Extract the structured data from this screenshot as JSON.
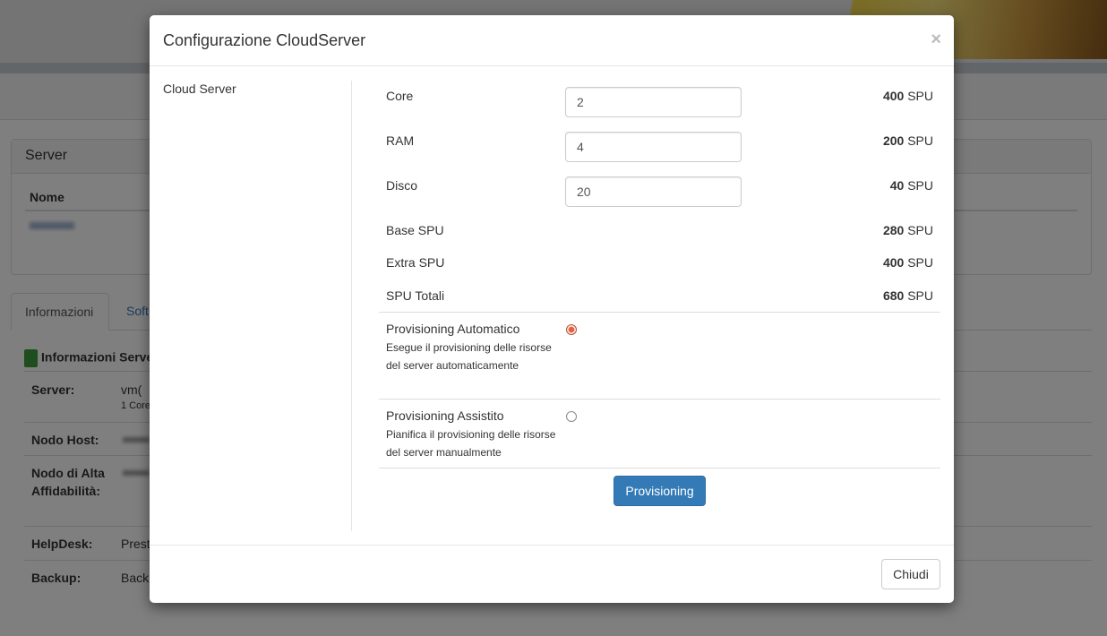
{
  "background": {
    "panel_title": "Server",
    "table_header_name": "Nome",
    "tabs": [
      {
        "label": "Informazioni"
      },
      {
        "label": "Soft"
      }
    ],
    "info_section_title": "Informazioni Serve",
    "info_rows": [
      {
        "label": "Server:",
        "value": "vm(",
        "sub": "1 Core"
      },
      {
        "label": "Nodo Host:",
        "value": ""
      },
      {
        "label": "Nodo di Alta Affidabilità:",
        "value": ""
      },
      {
        "label": "HelpDesk:",
        "value": "Prest"
      },
      {
        "label": "Backup:",
        "value": "Back"
      }
    ]
  },
  "modal": {
    "title": "Configurazione CloudServer",
    "close_symbol": "×",
    "sidebar_label": "Cloud Server",
    "inputs": [
      {
        "label": "Core",
        "value": "2",
        "price": "400",
        "unit": "SPU"
      },
      {
        "label": "RAM",
        "value": "4",
        "price": "200",
        "unit": "SPU"
      },
      {
        "label": "Disco",
        "value": "20",
        "price": "40",
        "unit": "SPU"
      }
    ],
    "summary": [
      {
        "label": "Base SPU",
        "price": "280",
        "unit": "SPU"
      },
      {
        "label": "Extra SPU",
        "price": "400",
        "unit": "SPU"
      },
      {
        "label": "SPU Totali",
        "price": "680",
        "unit": "SPU"
      }
    ],
    "options": [
      {
        "title": "Provisioning Automatico",
        "description": "Esegue il provisioning delle risorse del server automaticamente",
        "selected": true
      },
      {
        "title": "Provisioning Assistito",
        "description": "Pianifica il provisioning delle risorse del server manualmente",
        "selected": false
      }
    ],
    "provision_button": "Provisioning",
    "close_button": "Chiudi"
  }
}
